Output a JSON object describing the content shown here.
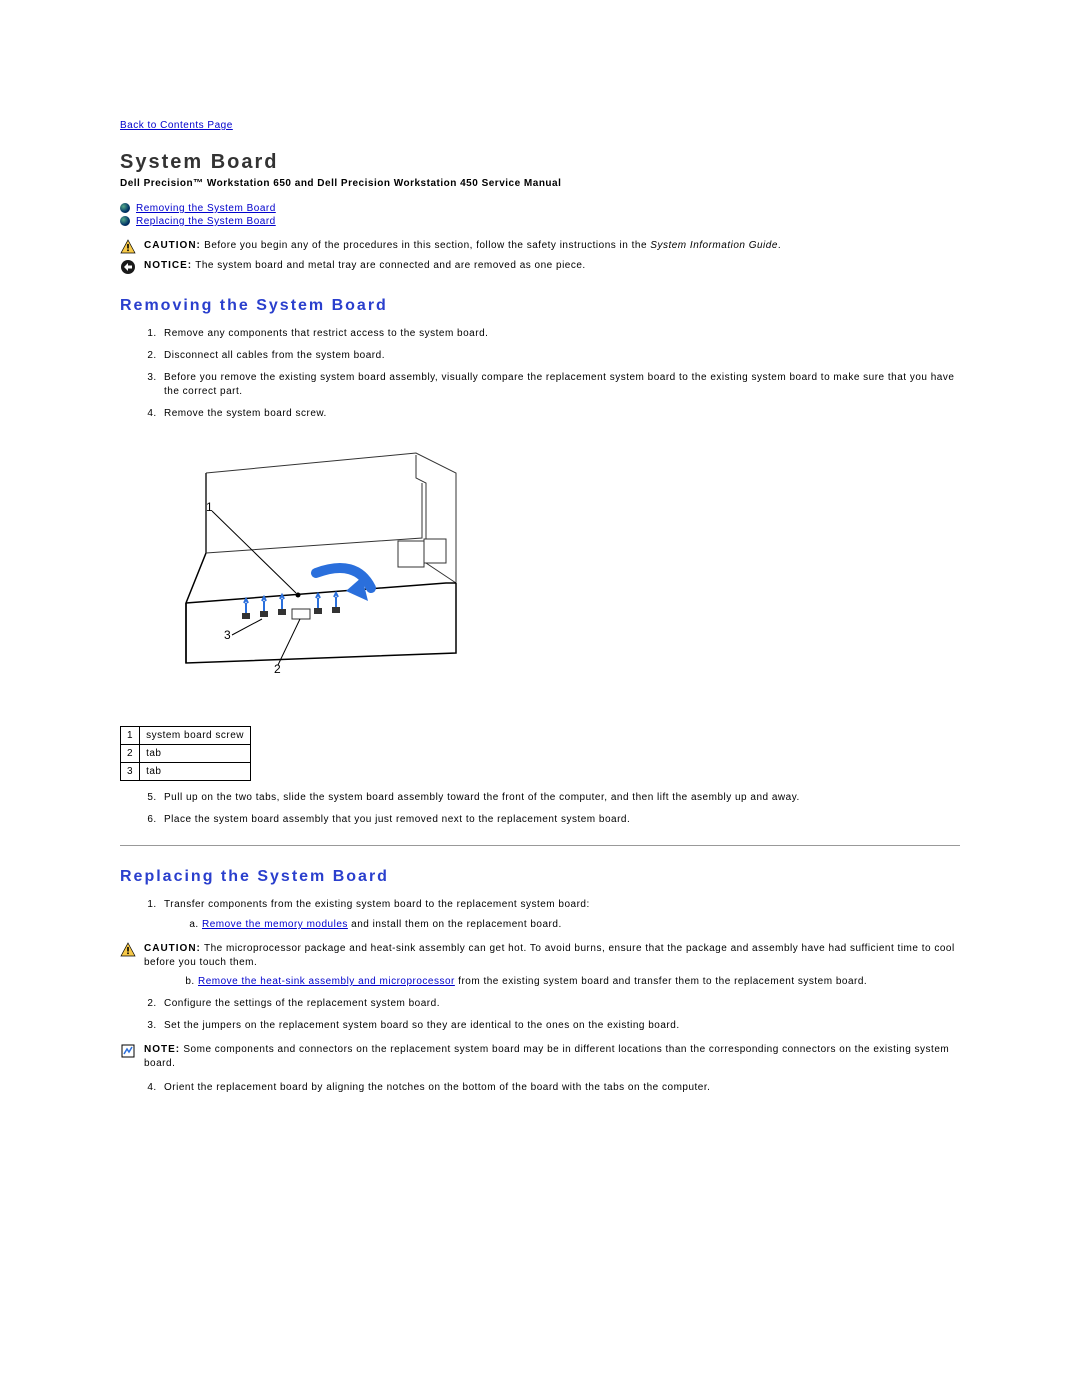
{
  "nav": {
    "back_link": "Back to Contents Page"
  },
  "header": {
    "title": "System Board",
    "subtitle": "Dell Precision™ Workstation 650 and Dell Precision Workstation 450 Service Manual"
  },
  "toc": {
    "link1": "Removing the System Board",
    "link2": "Replacing the System Board"
  },
  "caution1": {
    "label": "CAUTION:",
    "text_before": "Before you begin any of the procedures in this section, follow the safety instructions in the ",
    "italic": "System Information Guide",
    "text_after": "."
  },
  "notice1": {
    "label": "NOTICE:",
    "text": " The system board and metal tray are connected and are removed as one piece."
  },
  "removing": {
    "title": "Removing the System Board",
    "step1": "Remove any components that restrict access to the system board.",
    "step2": "Disconnect all cables from the system board.",
    "step3": "Before you remove the existing system board assembly, visually compare the replacement system board to the existing system board to make sure that you have the correct part.",
    "step4": "Remove the system board screw.",
    "step5": "Pull up on the two tabs, slide the system board assembly toward the front of the computer, and then lift the asembly up and away.",
    "step6": "Place the system board assembly that you just removed next to the replacement system board."
  },
  "callouts": {
    "r1n": "1",
    "r1t": "system board screw",
    "r2n": "2",
    "r2t": "tab",
    "r3n": "3",
    "r3t": "tab"
  },
  "replacing": {
    "title": "Replacing the System Board",
    "step1": "Transfer components from the existing system board to the replacement system board:",
    "step1a_link": "Remove the memory modules",
    "step1a_rest": " and install them on the replacement board.",
    "step1b_link": "Remove the heat-sink assembly and microprocessor",
    "step1b_rest": " from the existing system board and transfer them to the replacement system board.",
    "step2": "Configure the settings of the replacement system board.",
    "step3": "Set the jumpers on the replacement system board so they are identical to the ones on the existing board.",
    "step4": "Orient the replacement board by aligning the notches on the bottom of the board with the tabs on the computer."
  },
  "caution2": {
    "label": "CAUTION:",
    "text": " The microprocessor package and heat-sink assembly can get hot. To avoid burns, ensure that the package and assembly have had sufficient time to cool before you touch them."
  },
  "note1": {
    "label": "NOTE:",
    "text": " Some components and connectors on the replacement system board may be in different locations than the corresponding connectors on the existing system board."
  }
}
